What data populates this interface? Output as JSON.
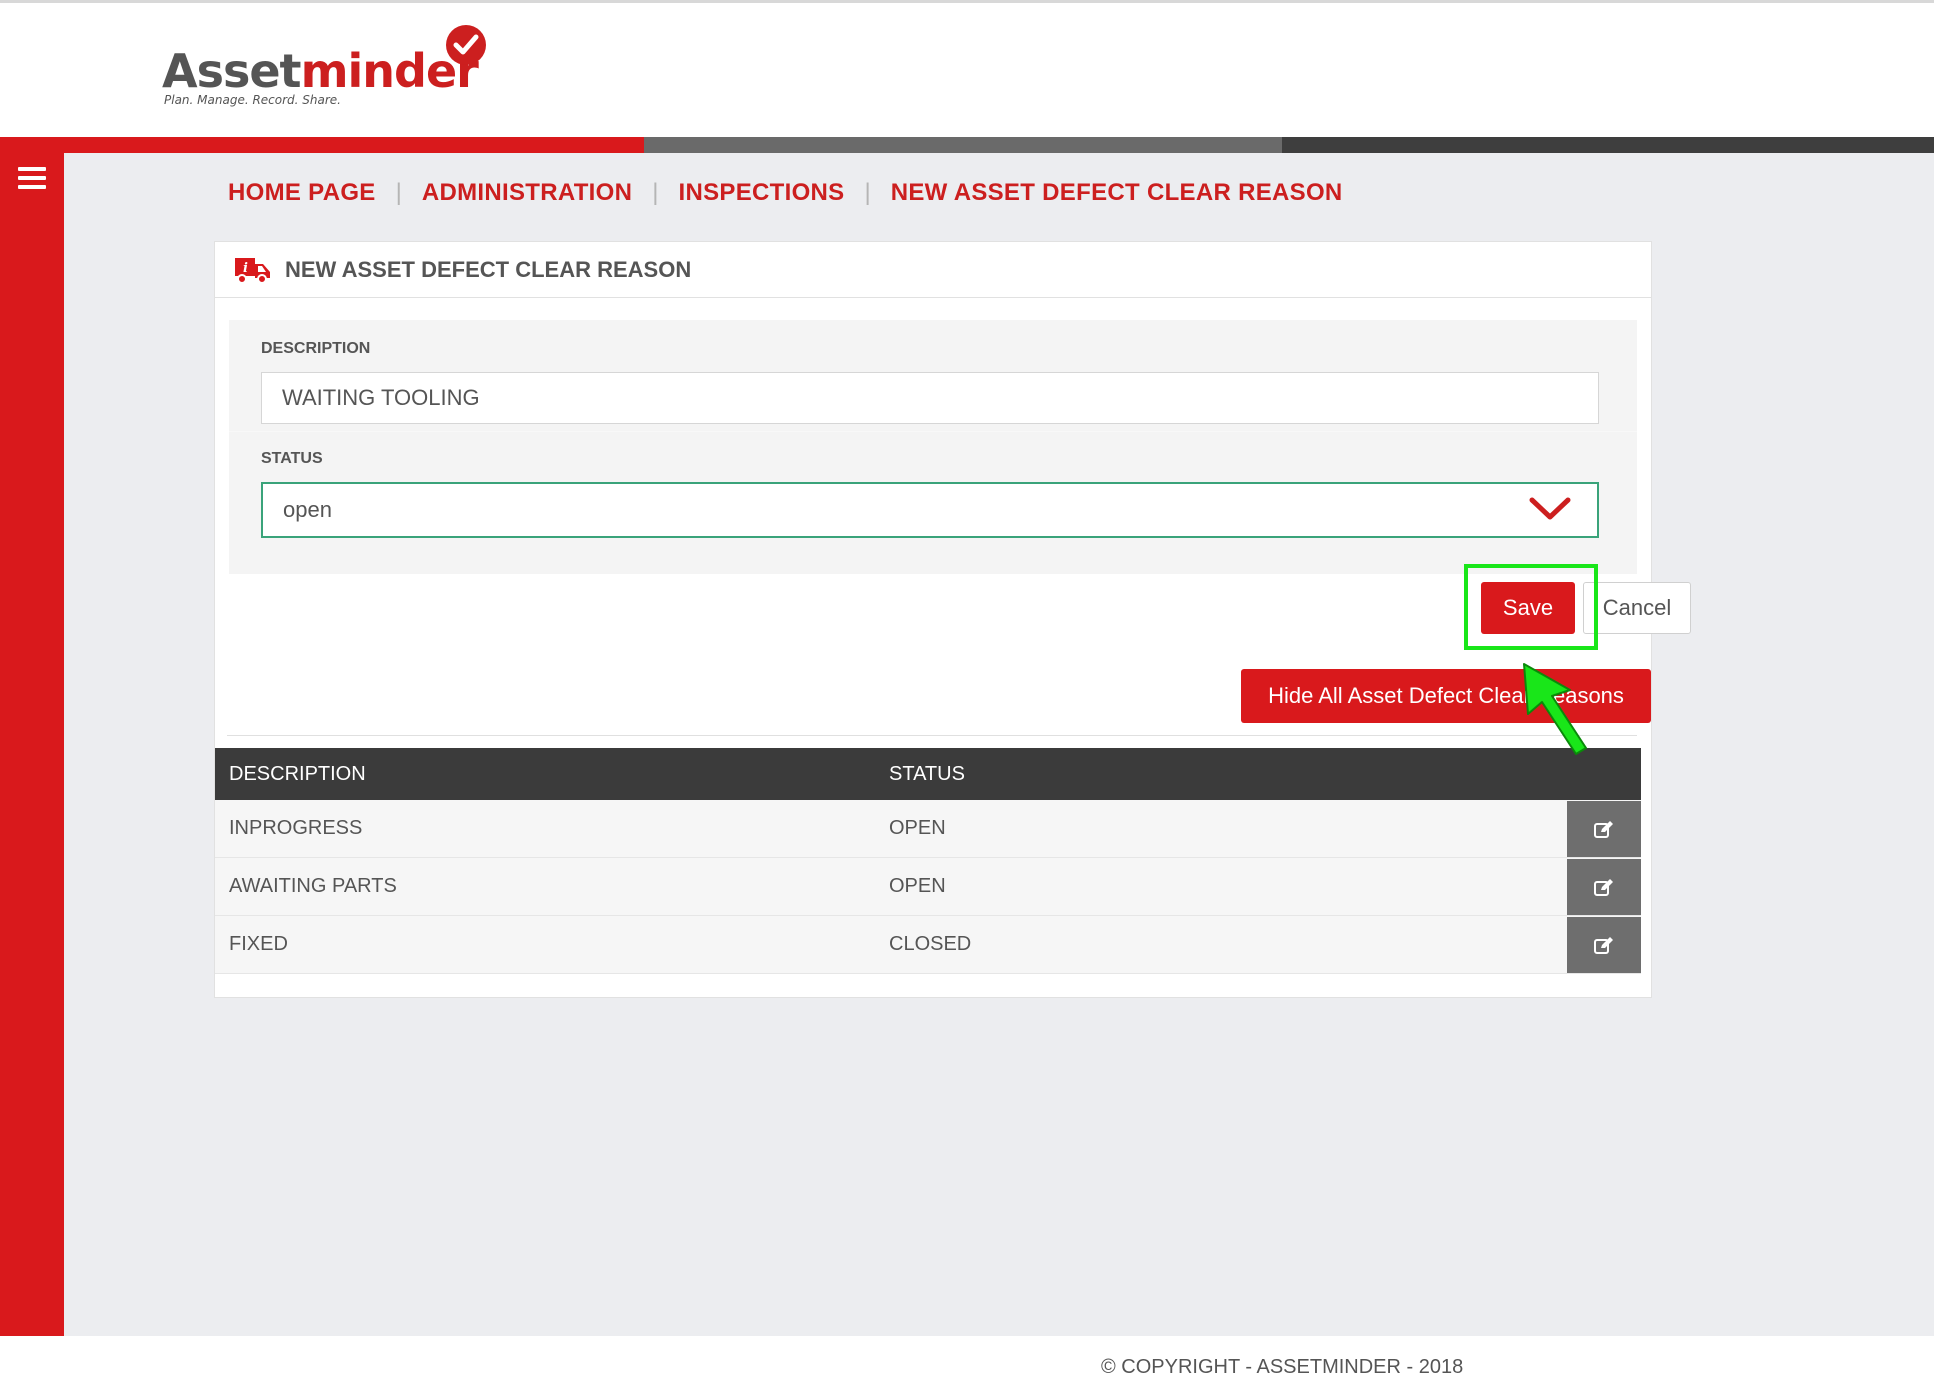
{
  "app": {
    "logo_text_a": "Asset",
    "logo_text_b": "minder",
    "tagline": "Plan. Manage. Record. Share.",
    "brand_color": "#d9191c"
  },
  "sidebar": {
    "menu_icon": "hamburger-icon"
  },
  "breadcrumb": {
    "items": [
      "HOME PAGE",
      "ADMINISTRATION",
      "INSPECTIONS",
      "NEW ASSET DEFECT CLEAR REASON"
    ],
    "separator": "|"
  },
  "card": {
    "icon": "truck-info-icon",
    "title": "NEW ASSET DEFECT CLEAR REASON"
  },
  "form": {
    "description_label": "DESCRIPTION",
    "description_value": "WAITING TOOLING",
    "status_label": "STATUS",
    "status_value": "open"
  },
  "buttons": {
    "save": "Save",
    "cancel": "Cancel",
    "hide_all": "Hide All Asset Defect Clear Reasons"
  },
  "table": {
    "headers": [
      "DESCRIPTION",
      "STATUS"
    ],
    "rows": [
      {
        "description": "INPROGRESS",
        "status": "OPEN"
      },
      {
        "description": "AWAITING PARTS",
        "status": "OPEN"
      },
      {
        "description": "FIXED",
        "status": "CLOSED"
      }
    ],
    "row_action_icon": "edit-icon"
  },
  "footer": {
    "copyright": "© COPYRIGHT - ASSETMINDER - 2018"
  },
  "annotation": {
    "highlight_color": "#19e619"
  }
}
